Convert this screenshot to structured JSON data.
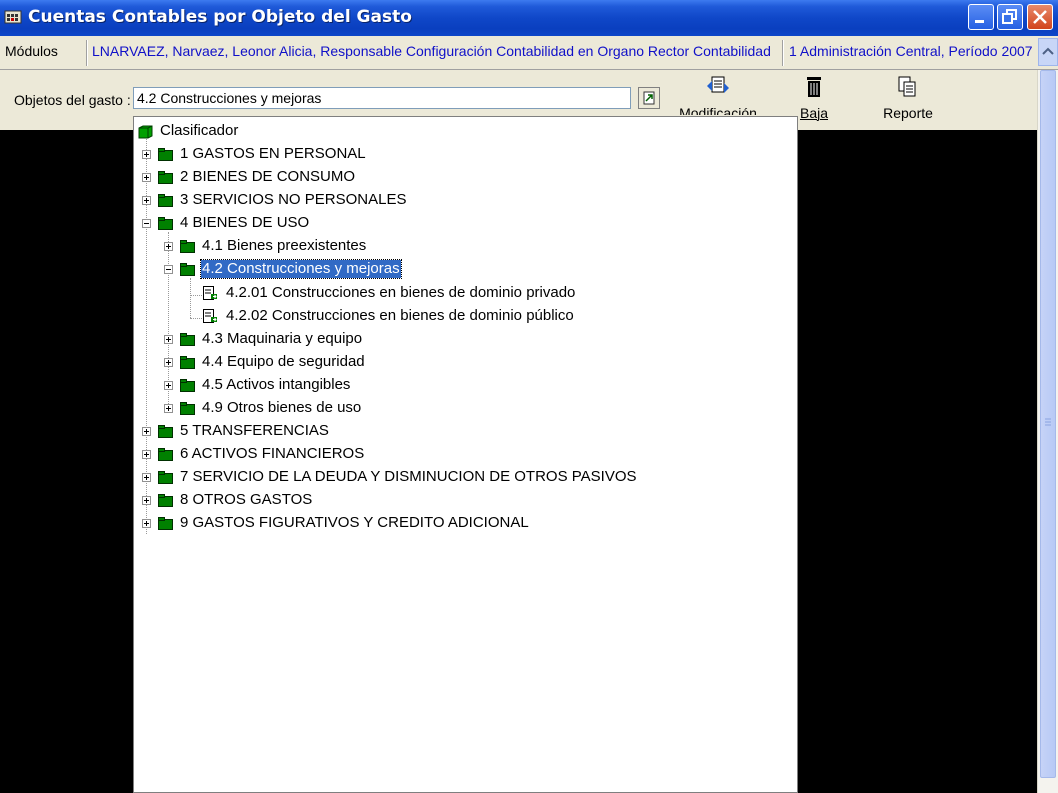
{
  "window": {
    "title": "Cuentas Contables por Objeto del Gasto"
  },
  "infobar": {
    "modulos": "Módulos",
    "user": "LNARVAEZ, Narvaez, Leonor Alicia, Responsable Configuración Contabilidad en Organo Rector Contabilidad",
    "admin": "1 Administración Central, Período 2007"
  },
  "toolbar": {
    "field_label": "Objetos del gasto :",
    "field_value": "4.2 Construcciones y mejoras",
    "modificacion": "Modificación",
    "baja": "Baja",
    "reporte": "Reporte"
  },
  "tree": {
    "root": "Clasificador",
    "items": [
      "1 GASTOS EN PERSONAL",
      "2 BIENES DE CONSUMO",
      "3 SERVICIOS NO PERSONALES",
      "4 BIENES DE USO",
      "4.1 Bienes preexistentes",
      "4.2 Construcciones y mejoras",
      "4.2.01 Construcciones en bienes de dominio privado",
      "4.2.02 Construcciones en bienes de dominio público",
      "4.3 Maquinaria y equipo",
      "4.4 Equipo de seguridad",
      "4.5 Activos intangibles",
      "4.9 Otros bienes de uso",
      "5 TRANSFERENCIAS",
      "6 ACTIVOS FINANCIEROS",
      "7 SERVICIO DE LA DEUDA Y DISMINUCION DE OTROS PASIVOS",
      "8 OTROS GASTOS",
      "9 GASTOS FIGURATIVOS Y CREDITO ADICIONAL"
    ]
  },
  "colors": {
    "folder": "#008000",
    "selection": "#316ac5",
    "titlebar": "#0a3fbf"
  }
}
